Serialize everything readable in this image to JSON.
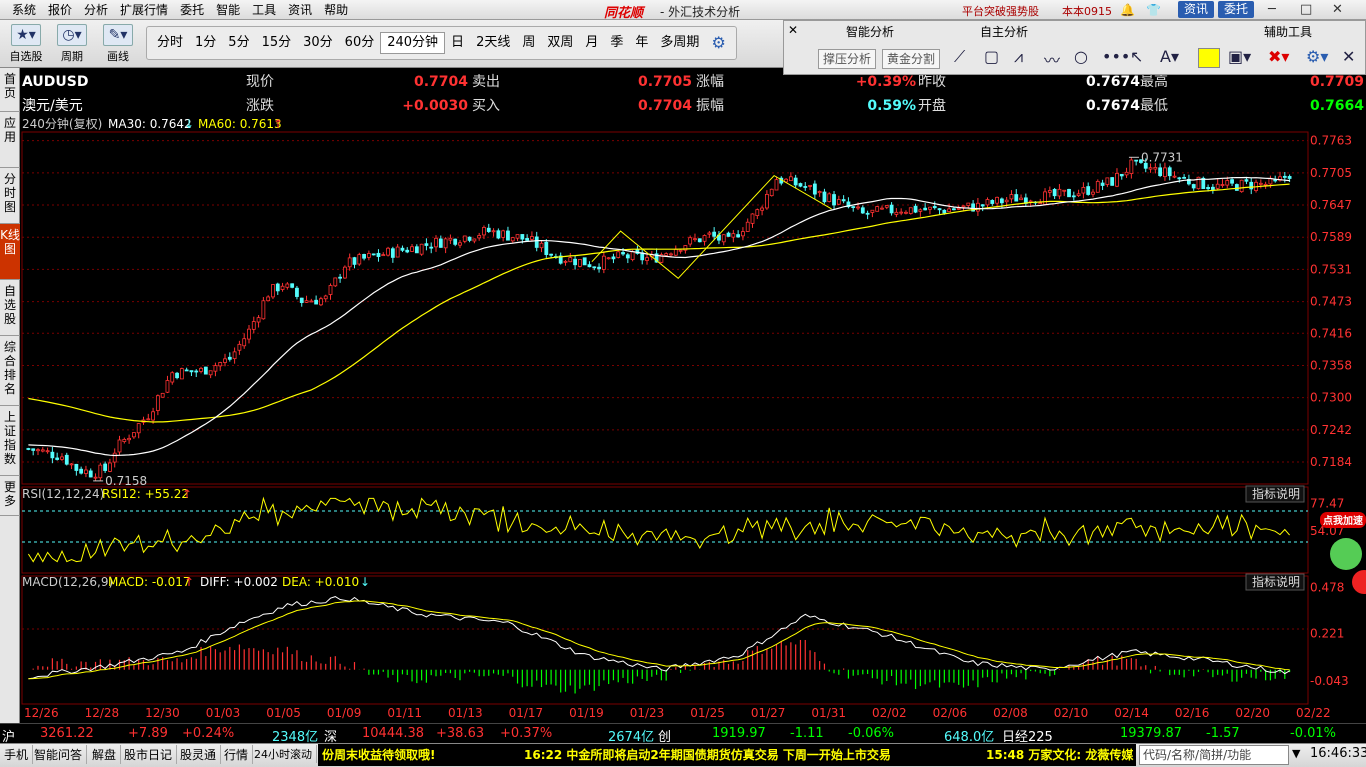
{
  "menubar": {
    "items": [
      "系统",
      "报价",
      "分析",
      "扩展行情",
      "委托",
      "智能",
      "工具",
      "资讯",
      "帮助"
    ],
    "brand": "同花顺",
    "subtitle": "- 外汇技术分析",
    "promo": "平台突破强势股",
    "version": "本本0915",
    "news_btn": "资讯",
    "trade_btn": "委托"
  },
  "toolbar": {
    "big": [
      "自选股",
      "周期",
      "画线"
    ],
    "periods": [
      "分时",
      "1分",
      "5分",
      "15分",
      "30分",
      "60分",
      "240分钟",
      "日",
      "2天线",
      "周",
      "双周",
      "月",
      "季",
      "年",
      "多周期"
    ],
    "selected": "240分钟"
  },
  "panel": {
    "smart": "智能分析",
    "self": "自主分析",
    "aux": "辅助工具",
    "btn1": "撑压分析",
    "btn2": "黄金分割"
  },
  "sidetabs": [
    "首页",
    "应用",
    "分时图",
    "K线图",
    "自选股",
    "综合排名",
    "上证指数",
    "更多"
  ],
  "quote": {
    "symbol": "AUDUSD",
    "name": "澳元/美元",
    "l_now": "现价",
    "now": "0.7704",
    "l_sell": "卖出",
    "sell": "0.7705",
    "l_pct": "涨幅",
    "pct": "+0.39%",
    "l_prev": "昨收",
    "prev": "0.7674",
    "l_high": "最高",
    "high": "0.7709",
    "l_chg": "涨跌",
    "chg": "+0.0030",
    "l_buy": "买入",
    "buy": "0.7704",
    "l_amp": "振幅",
    "amp": "0.59%",
    "l_open": "开盘",
    "open": "0.7674",
    "l_low": "最低",
    "low": "0.7664"
  },
  "ma_legend": {
    "period": "240分钟(复权)",
    "ma30": "MA30: 0.7642",
    "ma60": "MA60: 0.7613"
  },
  "rsi_legend": {
    "label": "RSI(12,12,24)",
    "value": "RSI12: +55.22",
    "help": "指标说明",
    "promo": "点我加速"
  },
  "macd_legend": {
    "label": "MACD(12,26,9)",
    "macd": "MACD: -0.017",
    "diff": "DIFF: +0.002",
    "dea": "DEA: +0.010",
    "help": "指标说明"
  },
  "colors": {
    "up": "#ff3232",
    "down": "#54fcfc",
    "ma30": "#ffffff",
    "ma60": "#ffff00",
    "grid": "#7a0000"
  },
  "chart_data": {
    "type": "candlestick",
    "price_ticks": [
      "0.7763",
      "0.7705",
      "0.7647",
      "0.7589",
      "0.7531",
      "0.7473",
      "0.7416",
      "0.7358",
      "0.7300",
      "0.7242",
      "0.7184"
    ],
    "price_range": [
      0.7148,
      0.7775
    ],
    "annotations": {
      "max_label": "0.7731",
      "min_label": "0.7158"
    },
    "rsi_ticks": [
      "77.47",
      "54.07"
    ],
    "macd_ticks": [
      "0.478",
      "0.221",
      "-0.043"
    ],
    "x_labels": [
      "12/26",
      "12/28",
      "12/30",
      "01/03",
      "01/05",
      "01/09",
      "01/11",
      "01/13",
      "01/17",
      "01/19",
      "01/23",
      "01/25",
      "01/27",
      "01/31",
      "02/02",
      "02/06",
      "02/08",
      "02/10",
      "02/14",
      "02/16",
      "02/20",
      "02/22"
    ],
    "trend_anchors": [
      [
        0,
        0.7208
      ],
      [
        7,
        0.7195
      ],
      [
        10,
        0.7172
      ],
      [
        13,
        0.7165
      ],
      [
        16,
        0.717
      ],
      [
        18,
        0.7205
      ],
      [
        25,
        0.727
      ],
      [
        30,
        0.7345
      ],
      [
        36,
        0.7348
      ],
      [
        42,
        0.737
      ],
      [
        46,
        0.742
      ],
      [
        50,
        0.7488
      ],
      [
        53,
        0.7505
      ],
      [
        57,
        0.7475
      ],
      [
        62,
        0.7478
      ],
      [
        66,
        0.754
      ],
      [
        72,
        0.7555
      ],
      [
        80,
        0.757
      ],
      [
        88,
        0.7585
      ],
      [
        96,
        0.76
      ],
      [
        104,
        0.7585
      ],
      [
        110,
        0.7555
      ],
      [
        118,
        0.754
      ],
      [
        124,
        0.7555
      ],
      [
        130,
        0.755
      ],
      [
        136,
        0.7575
      ],
      [
        142,
        0.7592
      ],
      [
        146,
        0.758
      ],
      [
        152,
        0.7635
      ],
      [
        156,
        0.7695
      ],
      [
        162,
        0.768
      ],
      [
        168,
        0.7655
      ],
      [
        174,
        0.763
      ],
      [
        182,
        0.764
      ],
      [
        190,
        0.7638
      ],
      [
        198,
        0.7645
      ],
      [
        206,
        0.766
      ],
      [
        214,
        0.7663
      ],
      [
        220,
        0.7672
      ],
      [
        226,
        0.769
      ],
      [
        230,
        0.7718
      ],
      [
        236,
        0.7708
      ],
      [
        242,
        0.769
      ],
      [
        248,
        0.768
      ],
      [
        254,
        0.7684
      ],
      [
        260,
        0.7685
      ],
      [
        263,
        0.7704
      ]
    ],
    "macd_anchors": [
      [
        0,
        -0.02
      ],
      [
        16,
        0.04
      ],
      [
        32,
        0.12
      ],
      [
        44,
        0.28
      ],
      [
        54,
        0.38
      ],
      [
        66,
        0.42
      ],
      [
        82,
        0.33
      ],
      [
        100,
        0.28
      ],
      [
        116,
        0.1
      ],
      [
        132,
        0.02
      ],
      [
        148,
        0.1
      ],
      [
        162,
        0.32
      ],
      [
        178,
        0.22
      ],
      [
        196,
        0.06
      ],
      [
        212,
        0.02
      ],
      [
        230,
        0.12
      ],
      [
        244,
        0.08
      ],
      [
        263,
        0.002
      ]
    ]
  },
  "status": {
    "sh_label": "沪",
    "sh_val": "3261.22",
    "sh_chg": "+7.89",
    "sh_pct": "+0.24%",
    "sh_amt": "2348亿",
    "sz_label": "深",
    "sz_val": "10444.38",
    "sz_chg": "+38.63",
    "sz_pct": "+0.37%",
    "sz_amt": "2674亿",
    "cy_label": "创",
    "cy_val": "1919.97",
    "cy_chg": "-1.11",
    "cy_pct": "-0.06%",
    "cy_amt": "648.0亿",
    "nk_label": "日经225",
    "nk_val": "19379.87",
    "nk_chg": "-1.57",
    "nk_pct": "-0.01%"
  },
  "bottom": {
    "tabs": [
      "手机",
      "智能问答",
      "解盘",
      "股市日记",
      "股灵通",
      "行情",
      "24小时滚动"
    ],
    "news1": "份周末收益待领取哦!",
    "news2": "16:22 中金所即将启动2年期国债期货仿真交易 下周一开始上市交易",
    "news3": "15:48 万家文化: 龙薇传媒",
    "search": "代码/名称/简拼/功能",
    "time": "16:46:33"
  }
}
